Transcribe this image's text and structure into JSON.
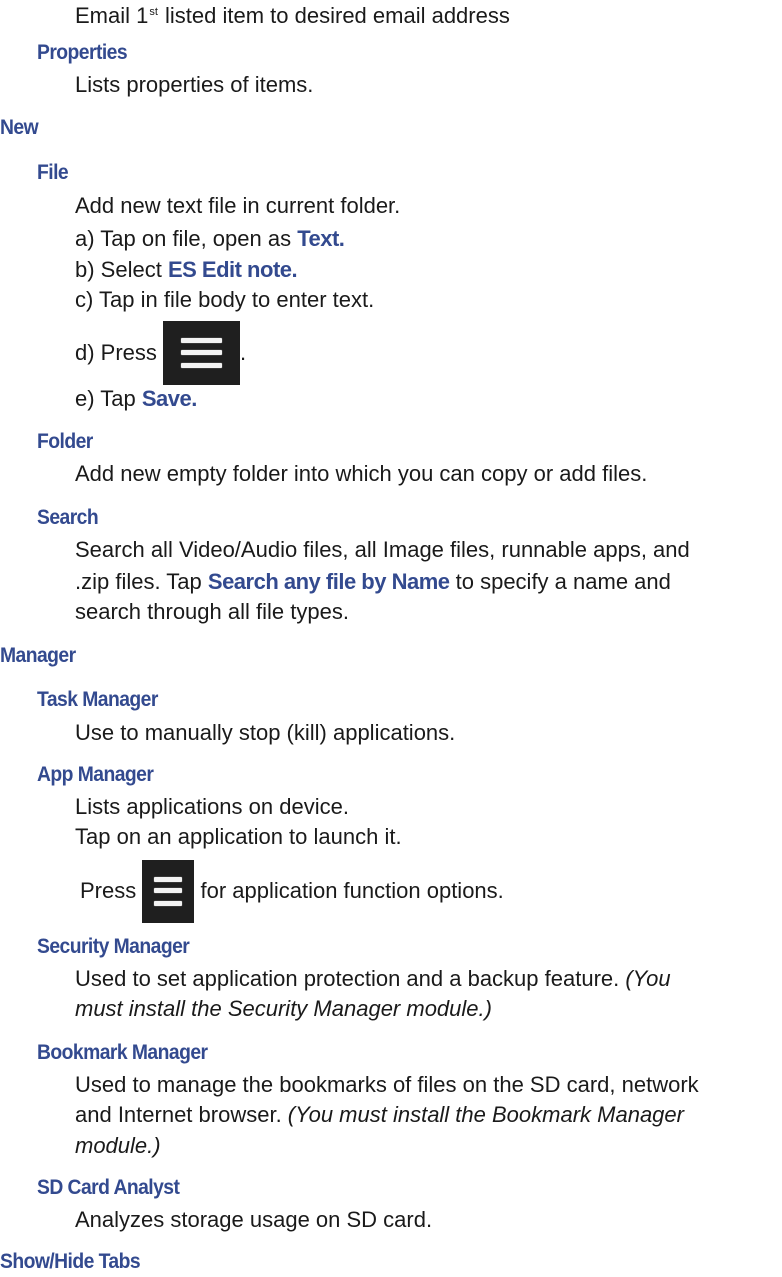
{
  "doc": {
    "intro_line": {
      "pre": "Email 1",
      "sup": "st",
      "post": " listed item to desired email address"
    },
    "properties": {
      "heading": "Properties",
      "desc": "Lists properties of items."
    },
    "new": {
      "heading": "New",
      "file": {
        "heading": "File",
        "desc": "Add new text file in current folder.",
        "step_a_pre": "a) Tap on file, open as ",
        "step_a_em": "Text.",
        "step_b_pre": "b) Select ",
        "step_b_em": "ES Edit note.",
        "step_c": "c) Tap in file body to enter text.",
        "step_d_pre": "d) Press ",
        "step_d_post": ".",
        "step_e_pre": "e) Tap ",
        "step_e_em": "Save."
      },
      "folder": {
        "heading": "Folder",
        "desc": "Add new empty folder into which you can copy or add files."
      },
      "search": {
        "heading": "Search",
        "line1": "Search all Video/Audio files, all Image files, runnable apps, and",
        "line2_pre": ".zip files. Tap ",
        "line2_em": "Search any file by Name",
        "line2_post": " to specify a name and",
        "line3": "search through all file types."
      }
    },
    "manager": {
      "heading": "Manager",
      "task": {
        "heading": "Task Manager",
        "desc": "Use to manually stop (kill) applications."
      },
      "app": {
        "heading": "App Manager",
        "line1": "Lists applications on device.",
        "line2": "Tap on an application to launch it.",
        "line3_pre": "Press ",
        "line3_post": " for application function options."
      },
      "security": {
        "heading": "Security Manager",
        "line1_pre": "Used to set application protection and a backup feature. ",
        "line1_em": "(You",
        "line2_em": "must install the Security Manager module.)"
      },
      "bookmark": {
        "heading": "Bookmark Manager",
        "line1": "Used to manage the bookmarks of files on the SD card, network",
        "line2_pre": "and Internet browser. ",
        "line2_em": "(You must install the Bookmark Manager",
        "line3_em": "module.)"
      },
      "sdcard": {
        "heading": "SD Card Analyst",
        "desc": "Analyzes storage usage on SD card."
      }
    },
    "showhide": {
      "heading": "Show/Hide Tabs"
    },
    "icons": {
      "menu": "menu-icon"
    }
  }
}
